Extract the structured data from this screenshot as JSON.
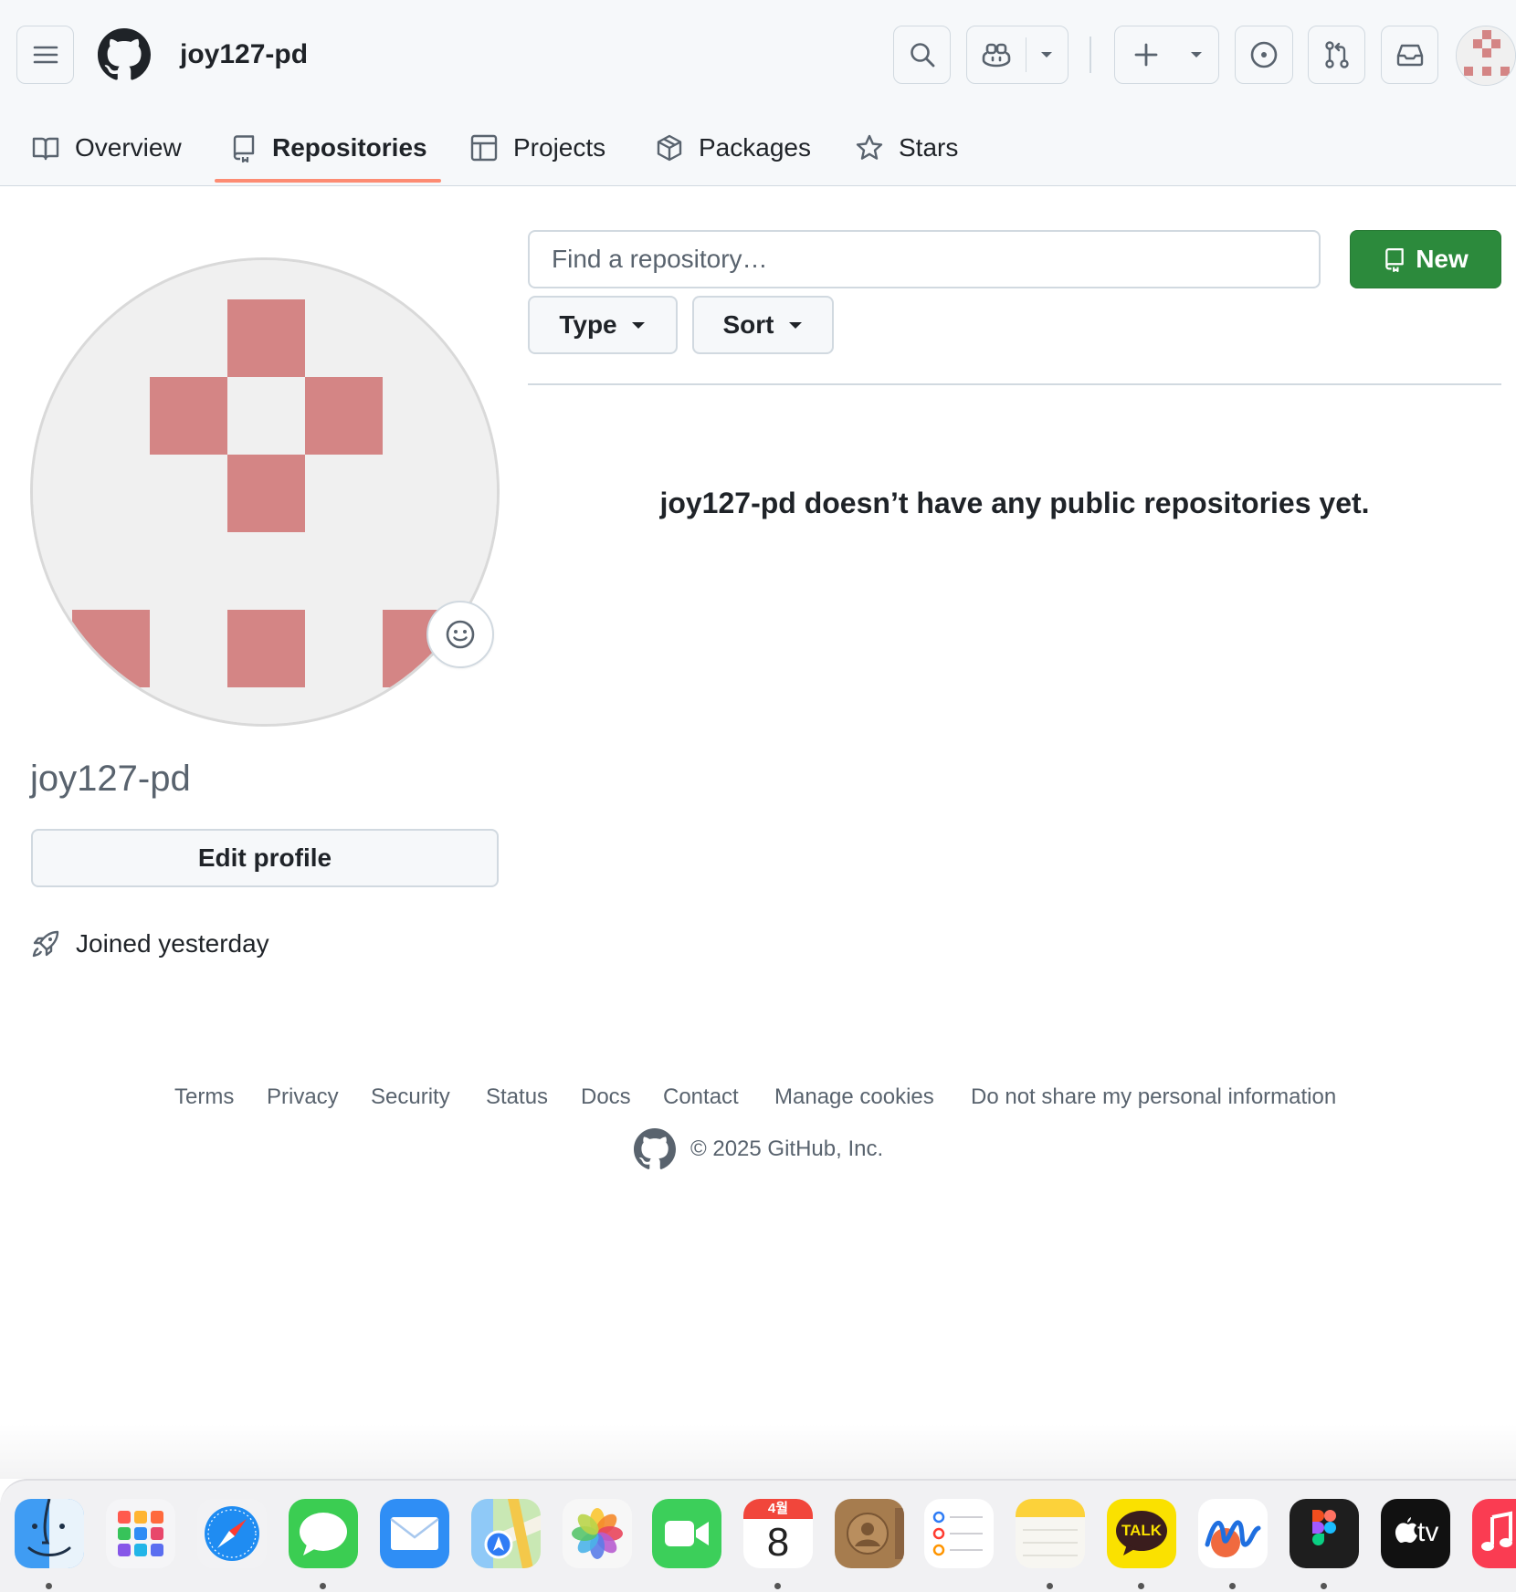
{
  "header": {
    "owner": "joy127-pd"
  },
  "tabs": [
    {
      "label": "Overview"
    },
    {
      "label": "Repositories"
    },
    {
      "label": "Projects"
    },
    {
      "label": "Packages"
    },
    {
      "label": "Stars"
    }
  ],
  "profile": {
    "username": "joy127-pd",
    "edit_label": "Edit profile",
    "joined": "Joined yesterday"
  },
  "repos": {
    "search_placeholder": "Find a repository…",
    "new_label": "New",
    "type_label": "Type",
    "sort_label": "Sort",
    "empty_message": "joy127-pd doesn’t have any public repositories yet."
  },
  "footer": {
    "links": [
      "Terms",
      "Privacy",
      "Security",
      "Status",
      "Docs",
      "Contact",
      "Manage cookies",
      "Do not share my personal information"
    ],
    "copyright": "© 2025 GitHub, Inc."
  },
  "dock": {
    "calendar_month": "4월",
    "calendar_day": "8",
    "kakao_label": "TALK",
    "tv_label": "tv"
  },
  "colors": {
    "accent_green": "#2c8a3c",
    "tab_underline": "#fd8c73",
    "identicon": "#d48585"
  }
}
